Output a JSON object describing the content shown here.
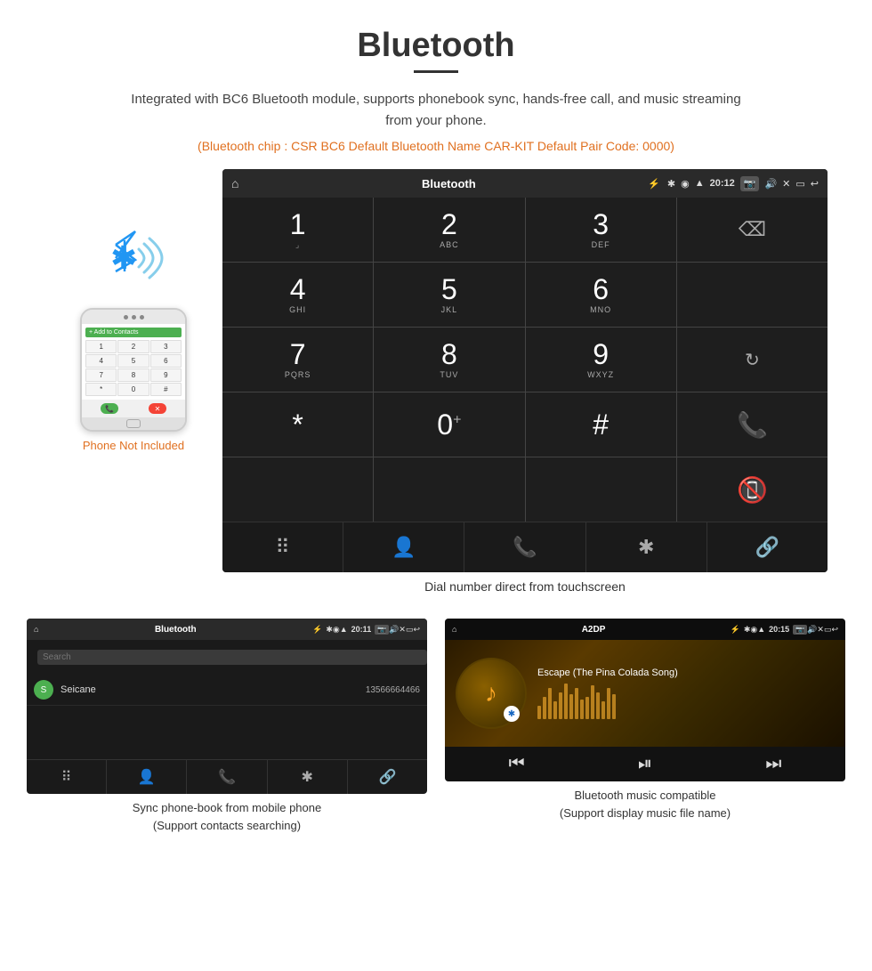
{
  "page": {
    "title": "Bluetooth",
    "description": "Integrated with BC6 Bluetooth module, supports phonebook sync, hands-free call, and music streaming from your phone.",
    "specs": "(Bluetooth chip : CSR BC6    Default Bluetooth Name CAR-KIT    Default Pair Code: 0000)",
    "dial_caption": "Dial number direct from touchscreen",
    "phone_not_included": "Phone Not Included"
  },
  "car_screen": {
    "status_bar": {
      "home_icon": "⌂",
      "title": "Bluetooth",
      "usb_icon": "⚡",
      "bt_icon": "✱",
      "location_icon": "◉",
      "wifi_icon": "▲",
      "time": "20:12",
      "camera_icon": "📷",
      "volume_icon": "🔊",
      "close_icon": "✕",
      "window_icon": "▭",
      "back_icon": "↩"
    },
    "dialpad": [
      {
        "main": "1",
        "sub": ""
      },
      {
        "main": "2",
        "sub": "ABC"
      },
      {
        "main": "3",
        "sub": "DEF"
      },
      {
        "main": "",
        "sub": "",
        "type": "backspace"
      },
      {
        "main": "4",
        "sub": "GHI"
      },
      {
        "main": "5",
        "sub": "JKL"
      },
      {
        "main": "6",
        "sub": "MNO"
      },
      {
        "main": "",
        "sub": "",
        "type": "empty"
      },
      {
        "main": "7",
        "sub": "PQRS"
      },
      {
        "main": "8",
        "sub": "TUV"
      },
      {
        "main": "9",
        "sub": "WXYZ"
      },
      {
        "main": "",
        "sub": "",
        "type": "reload"
      },
      {
        "main": "*",
        "sub": ""
      },
      {
        "main": "0",
        "sub": "+"
      },
      {
        "main": "#",
        "sub": ""
      },
      {
        "main": "",
        "sub": "",
        "type": "call-green"
      },
      {
        "main": "",
        "sub": "",
        "type": "empty"
      },
      {
        "main": "",
        "sub": "",
        "type": "empty"
      },
      {
        "main": "",
        "sub": "",
        "type": "empty"
      },
      {
        "main": "",
        "sub": "",
        "type": "call-red"
      }
    ],
    "nav_bar": [
      "⠿",
      "👤",
      "📞",
      "✱",
      "🔗"
    ]
  },
  "phonebook_screen": {
    "status_bar": {
      "home": "⌂",
      "title": "Bluetooth",
      "time": "20:11"
    },
    "search_placeholder": "Search",
    "contacts": [
      {
        "initial": "S",
        "name": "Seicane",
        "number": "13566664466"
      }
    ],
    "nav_icons": [
      "⠿",
      "👤",
      "📞",
      "✱",
      "🔗"
    ],
    "caption": "Sync phone-book from mobile phone\n(Support contacts searching)"
  },
  "music_screen": {
    "status_bar": {
      "home": "⌂",
      "title": "A2DP",
      "time": "20:15"
    },
    "song_title": "Escape (The Pina Colada Song)",
    "controls": [
      "⏮",
      "⏯",
      "⏭"
    ],
    "viz_bars": [
      15,
      25,
      35,
      20,
      30,
      40,
      28,
      35,
      20,
      25,
      38,
      30,
      22,
      35,
      28
    ],
    "caption": "Bluetooth music compatible\n(Support display music file name)"
  },
  "phone_mockup": {
    "keys": [
      "1",
      "2",
      "3",
      "4",
      "5",
      "6",
      "7",
      "8",
      "9",
      "*",
      "0",
      "#"
    ],
    "add_contacts": "+ Add to Contacts"
  }
}
